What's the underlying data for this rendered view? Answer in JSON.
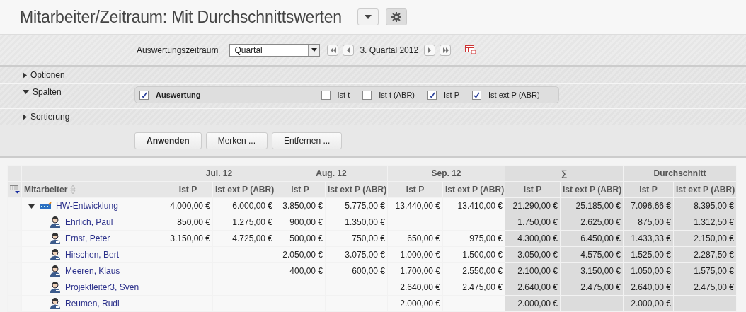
{
  "title": "Mitarbeiter/Zeitraum: Mit Durchschnittswerten",
  "period": {
    "label": "Auswertungszeitraum",
    "select_value": "Quartal",
    "current": "3. Quartal 2012"
  },
  "sections": [
    {
      "label": "Optionen",
      "expanded": false
    },
    {
      "label": "Spalten",
      "expanded": true
    },
    {
      "label": "Sortierung",
      "expanded": false
    }
  ],
  "column_options": [
    {
      "label": "Auswertung",
      "checked": true
    },
    {
      "label": "Ist t",
      "checked": false
    },
    {
      "label": "Ist t (ABR)",
      "checked": false
    },
    {
      "label": "Ist P",
      "checked": true
    },
    {
      "label": "Ist ext P (ABR)",
      "checked": true
    }
  ],
  "buttons": [
    {
      "label": "Anwenden",
      "primary": true
    },
    {
      "label": "Merken ...",
      "primary": false
    },
    {
      "label": "Entfernen ...",
      "primary": false
    }
  ],
  "table": {
    "name_header": "Mitarbeiter",
    "groups": [
      {
        "label": "Jul. 12",
        "kind": "period"
      },
      {
        "label": "Aug. 12",
        "kind": "period"
      },
      {
        "label": "Sep. 12",
        "kind": "period"
      },
      {
        "label": "∑",
        "kind": "summary"
      },
      {
        "label": "Durchschnitt",
        "kind": "summary"
      }
    ],
    "sub_headers": [
      "Ist P",
      "Ist ext P (ABR)",
      "Ist P",
      "Ist ext P (ABR)",
      "Ist P",
      "Ist ext P (ABR)",
      "Ist P",
      "Ist ext P (ABR)",
      "Ist P",
      "Ist ext P (ABR)"
    ],
    "rows": [
      {
        "name": "HW-Entwicklung",
        "kind": "department",
        "expanded": true,
        "cells": [
          "4.000,00 €",
          "6.000,00 €",
          "3.850,00 €",
          "5.775,00 €",
          "13.440,00 €",
          "13.410,00 €",
          "21.290,00 €",
          "25.185,00 €",
          "7.096,66 €",
          "8.395,00 €"
        ],
        "children": [
          {
            "name": "Ehrlich, Paul",
            "kind": "person",
            "cells": [
              "850,00 €",
              "1.275,00 €",
              "900,00 €",
              "1.350,00 €",
              null,
              null,
              "1.750,00 €",
              "2.625,00 €",
              "875,00 €",
              "1.312,50 €"
            ]
          },
          {
            "name": "Ernst, Peter",
            "kind": "person",
            "cells": [
              "3.150,00 €",
              "4.725,00 €",
              "500,00 €",
              "750,00 €",
              "650,00 €",
              "975,00 €",
              "4.300,00 €",
              "6.450,00 €",
              "1.433,33 €",
              "2.150,00 €"
            ]
          },
          {
            "name": "Hirschen, Bert",
            "kind": "person",
            "cells": [
              null,
              null,
              "2.050,00 €",
              "3.075,00 €",
              "1.000,00 €",
              "1.500,00 €",
              "3.050,00 €",
              "4.575,00 €",
              "1.525,00 €",
              "2.287,50 €"
            ]
          },
          {
            "name": "Meeren, Klaus",
            "kind": "person",
            "cells": [
              null,
              null,
              "400,00 €",
              "600,00 €",
              "1.700,00 €",
              "2.550,00 €",
              "2.100,00 €",
              "3.150,00 €",
              "1.050,00 €",
              "1.575,00 €"
            ]
          },
          {
            "name": "Projektleiter3, Sven",
            "kind": "person",
            "cells": [
              null,
              null,
              null,
              null,
              "2.640,00 €",
              "2.475,00 €",
              "2.640,00 €",
              "2.475,00 €",
              "2.640,00 €",
              "2.475,00 €"
            ]
          },
          {
            "name": "Reumen, Rudi",
            "kind": "person",
            "cells": [
              null,
              null,
              null,
              null,
              "2.000,00 €",
              null,
              "2.000,00 €",
              null,
              "2.000,00 €",
              null
            ]
          }
        ]
      }
    ]
  }
}
